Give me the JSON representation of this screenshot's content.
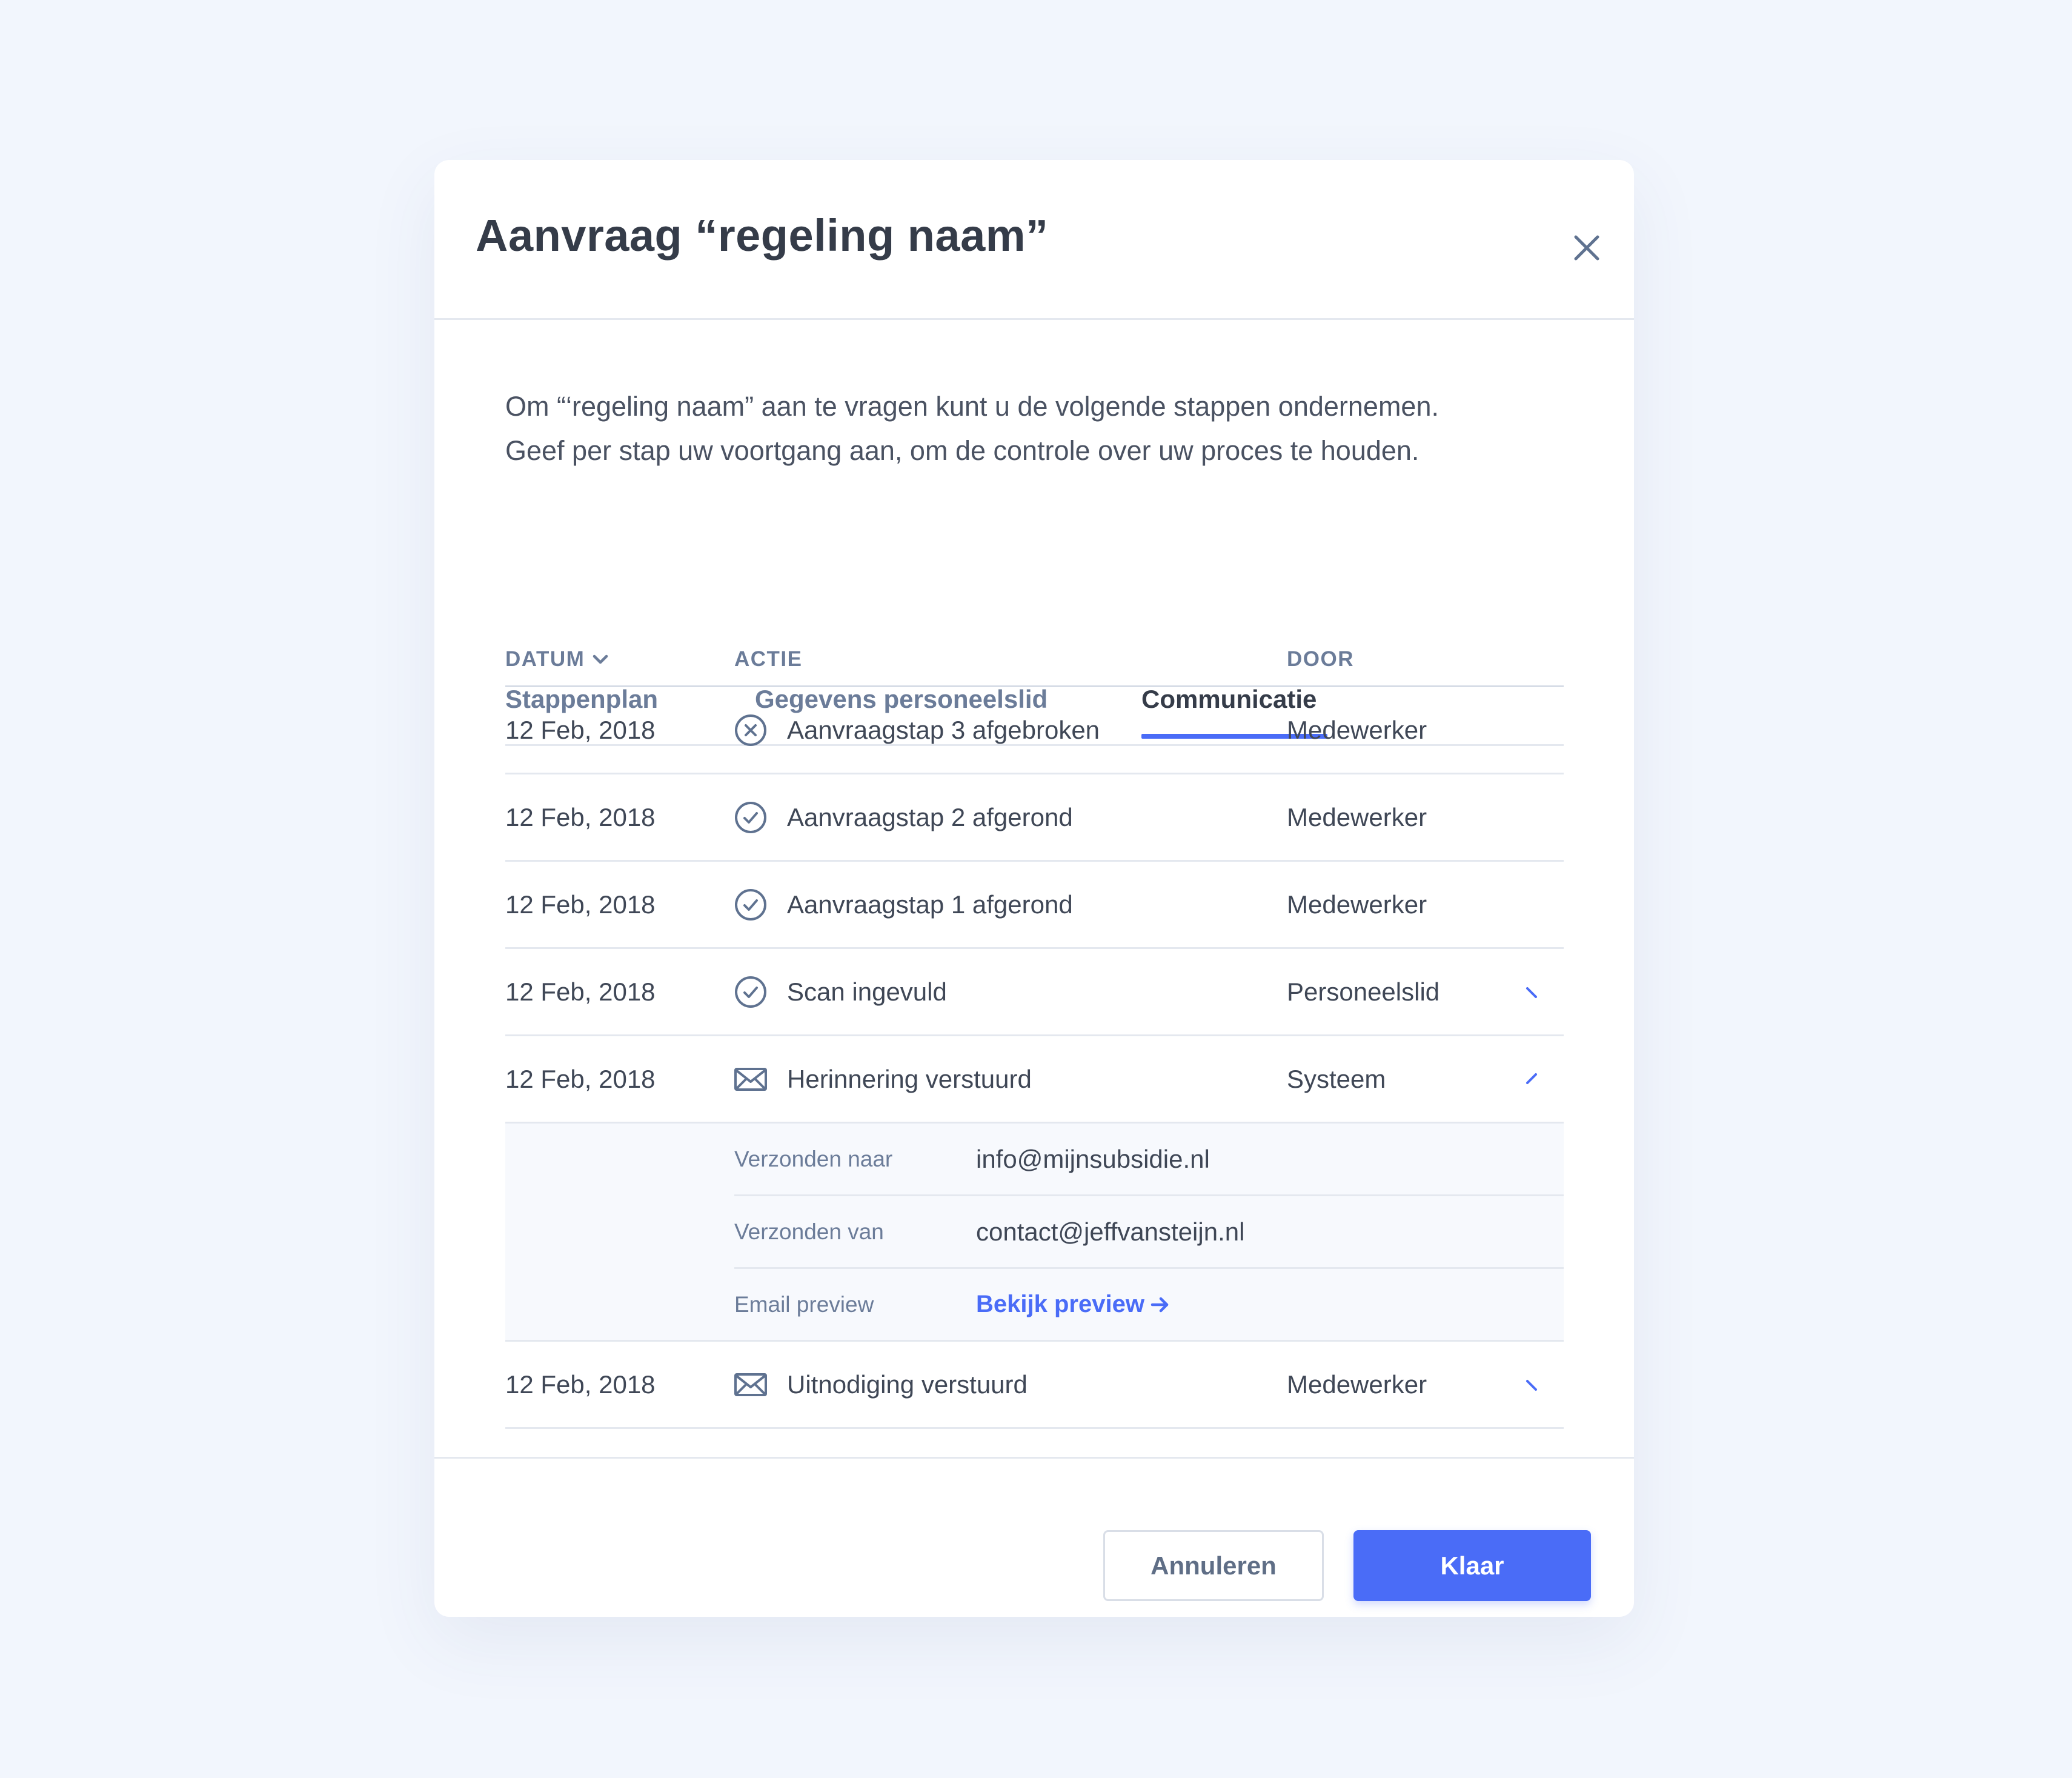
{
  "modal": {
    "title": "Aanvraag “regeling naam”",
    "close_icon": "close-icon",
    "intro_line1": "Om “‘regeling naam” aan te vragen kunt u de volgende stappen ondernemen.",
    "intro_line2": "Geef per stap uw voortgang aan, om de controle over uw proces te houden."
  },
  "tabs": [
    {
      "label": "Stappenplan",
      "active": false
    },
    {
      "label": "Gegevens personeelslid",
      "active": false
    },
    {
      "label": "Communicatie",
      "active": true
    }
  ],
  "table": {
    "headers": {
      "datum": "DATUM",
      "actie": "ACTIE",
      "door": "DOOR"
    },
    "sort_icon": "chevron-down-icon",
    "rows": [
      {
        "date": "12 Feb, 2018",
        "icon": "x-circle-icon",
        "action": "Aanvraagstap 3 afgebroken",
        "by": "Medewerker",
        "toggle": "none"
      },
      {
        "date": "12 Feb, 2018",
        "icon": "check-circle-icon",
        "action": "Aanvraagstap 2 afgerond",
        "by": "Medewerker",
        "toggle": "none"
      },
      {
        "date": "12 Feb, 2018",
        "icon": "check-circle-icon",
        "action": "Aanvraagstap 1 afgerond",
        "by": "Medewerker",
        "toggle": "none"
      },
      {
        "date": "12 Feb, 2018",
        "icon": "check-circle-icon",
        "action": "Scan ingevuld",
        "by": "Personeelslid",
        "toggle": "collapsed"
      },
      {
        "date": "12 Feb, 2018",
        "icon": "mail-icon",
        "action": "Herinnering verstuurd",
        "by": "Systeem",
        "toggle": "expanded"
      },
      {
        "date": "12 Feb, 2018",
        "icon": "mail-icon",
        "action": "Uitnodiging verstuurd",
        "by": "Medewerker",
        "toggle": "collapsed"
      }
    ],
    "details": {
      "sent_to_label": "Verzonden naar",
      "sent_to_value": "info@mijnsubsidie.nl",
      "sent_from_label": "Verzonden van",
      "sent_from_value": "contact@jeffvansteijn.nl",
      "preview_label": "Email preview",
      "preview_link": "Bekijk preview",
      "preview_icon": "arrow-right-icon"
    }
  },
  "footer": {
    "cancel_label": "Annuleren",
    "done_label": "Klaar"
  },
  "colors": {
    "accent": "#4a6cf7",
    "background": "#f2f6fd",
    "text": "#3f4756",
    "muted": "#6b7c99"
  }
}
